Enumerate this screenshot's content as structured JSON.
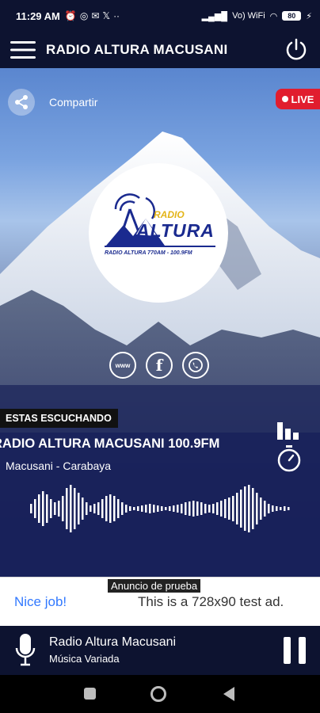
{
  "status_bar": {
    "time": "11:29 AM",
    "network": "Vo) WiFi",
    "battery": "80"
  },
  "app_bar": {
    "title": "RADIO ALTURA MACUSANI"
  },
  "hero": {
    "share_label": "Compartir",
    "live_label": "LIVE",
    "logo": {
      "radio": "RADIO",
      "altura": "ALTURA",
      "freq": "RADIO ALTURA 770AM - 100.9FM"
    },
    "social": [
      "www-icon",
      "facebook-icon",
      "whatsapp-icon"
    ],
    "listening_label": "ESTAS ESCUCHANDO",
    "station_name": "RADIO ALTURA MACUSANI 100.9FM",
    "station_location": "Macusani - Carabaya"
  },
  "ad": {
    "tag": "Anuncio de prueba",
    "nice": "Nice job!",
    "text": "This is a 728x90 test ad."
  },
  "player": {
    "title": "Radio Altura Macusani",
    "subtitle": "Música Variada"
  },
  "colors": {
    "bar": "#0d1330",
    "live": "#e11d2e",
    "ad_link": "#3279ff"
  }
}
